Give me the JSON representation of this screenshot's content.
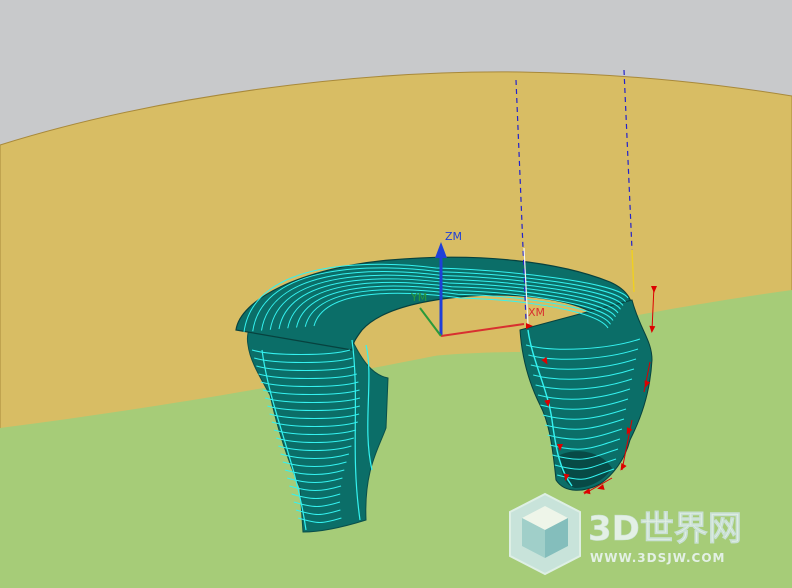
{
  "viewport": {
    "axes": {
      "z_label": "ZM",
      "y_label": "YM",
      "x_label": "XM"
    }
  },
  "watermark": {
    "brand": "3D世界网",
    "url": "WWW.3DSJW.COM"
  },
  "colors": {
    "background_top": "#c8c9cb",
    "stock_surface": "#d8bd64",
    "floor_surface": "#a6cc78",
    "part_body": "#0b6e68",
    "part_dark": "#074a46",
    "toolpath": "#34f2f0",
    "approach_path": "#2222cc",
    "feed_arrow": "#dd0000",
    "axis_z": "#1f3fd8",
    "axis_x": "#d83030",
    "axis_y": "#2a9a3a"
  }
}
